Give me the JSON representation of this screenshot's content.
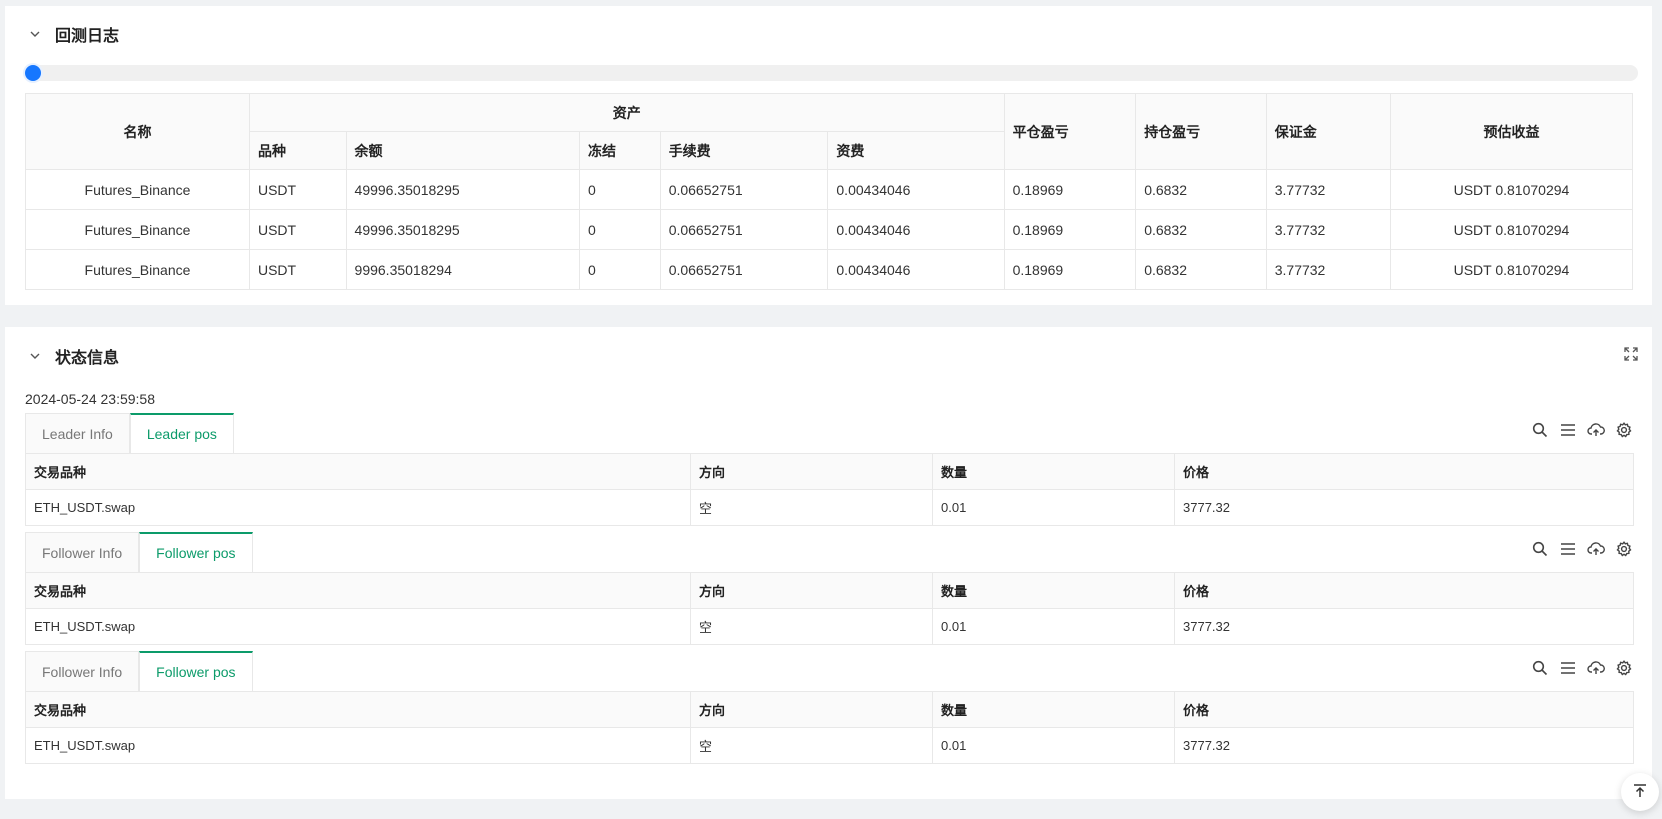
{
  "backtest_log": {
    "title": "回测日志",
    "progress": 0,
    "headers": {
      "name": "名称",
      "assets": "资产",
      "asset_cols": [
        "品种",
        "余额",
        "冻结",
        "手续费",
        "资费"
      ],
      "close_pnl": "平仓盈亏",
      "hold_pnl": "持仓盈亏",
      "margin": "保证金",
      "est_profit": "预估收益"
    },
    "rows": [
      [
        "Futures_Binance",
        "USDT",
        "49996.35018295",
        "0",
        "0.06652751",
        "0.00434046",
        "0.18969",
        "0.6832",
        "3.77732",
        "USDT 0.81070294"
      ],
      [
        "Futures_Binance",
        "USDT",
        "49996.35018295",
        "0",
        "0.06652751",
        "0.00434046",
        "0.18969",
        "0.6832",
        "3.77732",
        "USDT 0.81070294"
      ],
      [
        "Futures_Binance",
        "USDT",
        "9996.35018294",
        "0",
        "0.06652751",
        "0.00434046",
        "0.18969",
        "0.6832",
        "3.77732",
        "USDT 0.81070294"
      ]
    ]
  },
  "status": {
    "title": "状态信息",
    "timestamp": "2024-05-24 23:59:58",
    "blocks": [
      {
        "tabs": [
          "Leader Info",
          "Leader pos"
        ],
        "active": 1,
        "columns": [
          "交易品种",
          "方向",
          "数量",
          "价格"
        ],
        "row": [
          "ETH_USDT.swap",
          "空",
          "0.01",
          "3777.32"
        ]
      },
      {
        "tabs": [
          "Follower Info",
          "Follower pos"
        ],
        "active": 1,
        "columns": [
          "交易品种",
          "方向",
          "数量",
          "价格"
        ],
        "row": [
          "ETH_USDT.swap",
          "空",
          "0.01",
          "3777.32"
        ]
      },
      {
        "tabs": [
          "Follower Info",
          "Follower pos"
        ],
        "active": 1,
        "columns": [
          "交易品种",
          "方向",
          "数量",
          "价格"
        ],
        "row": [
          "ETH_USDT.swap",
          "空",
          "0.01",
          "3777.32"
        ]
      }
    ]
  },
  "colors": {
    "accent": "#0c9b6a",
    "progress": "#1677ff"
  },
  "icons": [
    "chevron-down-icon",
    "expand-icon",
    "search-icon",
    "list-icon",
    "cloud-upload-icon",
    "gear-icon",
    "back-to-top-icon"
  ]
}
